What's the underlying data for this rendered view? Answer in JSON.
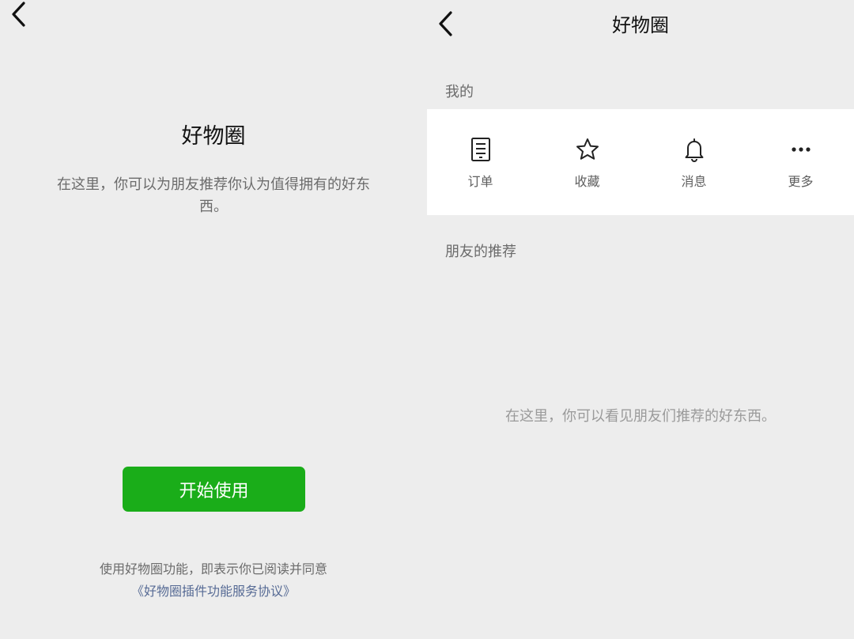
{
  "intro": {
    "title": "好物圈",
    "description": "在这里，你可以为朋友推荐你认为值得拥有的好东西。",
    "start_button": "开始使用",
    "agreement_text": "使用好物圈功能，即表示你已阅读并同意",
    "agreement_link": "《好物圈插件功能服务协议》"
  },
  "main": {
    "title": "好物圈",
    "mine_label": "我的",
    "mine_items": [
      {
        "label": "订单",
        "icon": "order-icon"
      },
      {
        "label": "收藏",
        "icon": "star-icon"
      },
      {
        "label": "消息",
        "icon": "bell-icon"
      },
      {
        "label": "更多",
        "icon": "more-icon"
      }
    ],
    "friends_label": "朋友的推荐",
    "empty_hint": "在这里，你可以看见朋友们推荐的好东西。"
  },
  "colors": {
    "background": "#ededed",
    "primary_button": "#1aad19",
    "link": "#576b95"
  }
}
